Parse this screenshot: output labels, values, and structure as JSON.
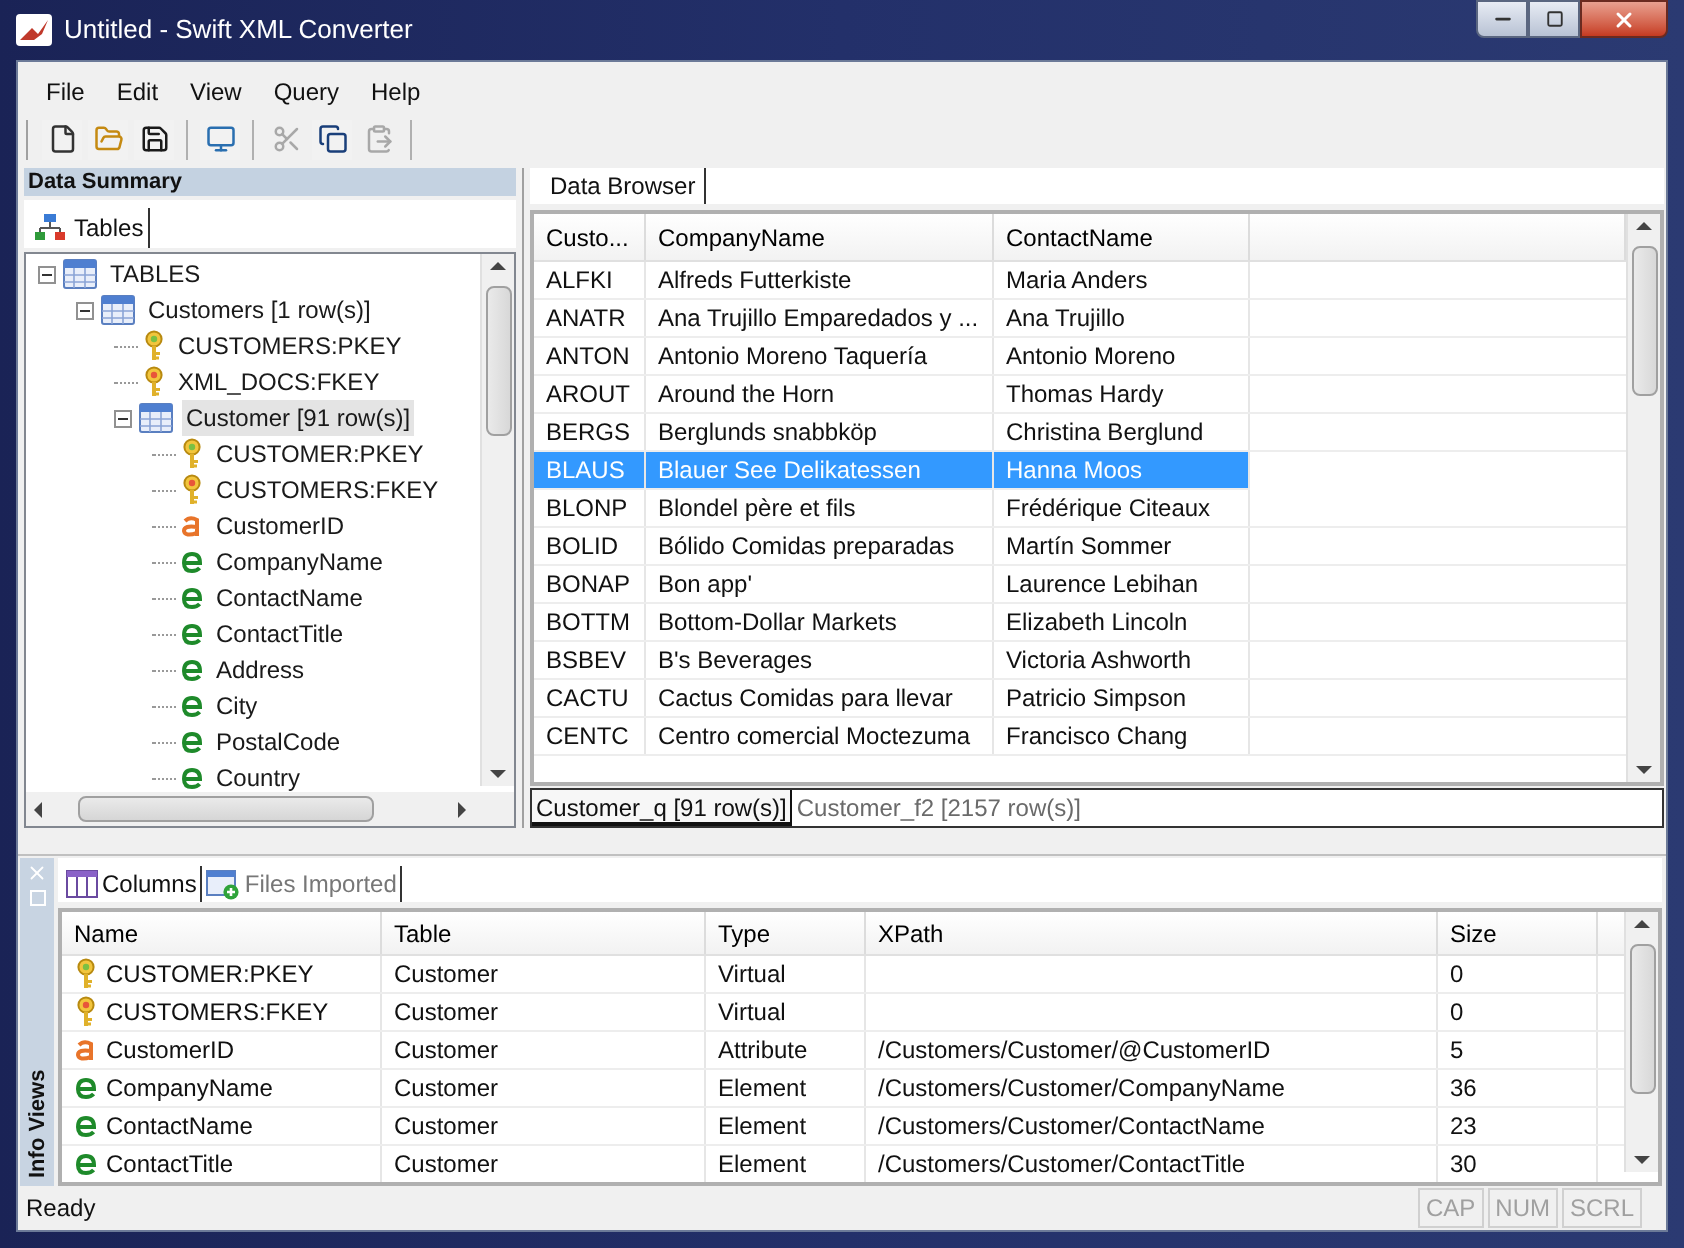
{
  "window": {
    "title": "Untitled - Swift XML Converter"
  },
  "menu": [
    "File",
    "Edit",
    "View",
    "Query",
    "Help"
  ],
  "toolbar": [
    {
      "kind": "new",
      "disabled": false
    },
    {
      "kind": "open",
      "disabled": false
    },
    {
      "kind": "save",
      "disabled": false
    },
    {
      "kind": "separator"
    },
    {
      "kind": "preview",
      "disabled": false
    },
    {
      "kind": "separator"
    },
    {
      "kind": "cut",
      "disabled": true
    },
    {
      "kind": "copy",
      "disabled": false
    },
    {
      "kind": "paste",
      "disabled": true
    }
  ],
  "data_summary": {
    "title": "Data Summary",
    "tabs": [
      {
        "label": "Tables",
        "selected": true
      }
    ],
    "tree": [
      {
        "label": "TABLES",
        "kind": "table",
        "expanded": true,
        "selected": false,
        "children": [
          {
            "label": "Customers [1 row(s)]",
            "kind": "table",
            "expanded": true,
            "selected": false,
            "children": [
              {
                "label": "CUSTOMERS:PKEY",
                "kind": "primary-key",
                "selected": false
              },
              {
                "label": "XML_DOCS:FKEY",
                "kind": "foreign-key",
                "selected": false
              },
              {
                "label": "Customer [91 row(s)]",
                "kind": "table",
                "expanded": true,
                "selected": true,
                "children": [
                  {
                    "label": "CUSTOMER:PKEY",
                    "kind": "primary-key",
                    "selected": false
                  },
                  {
                    "label": "CUSTOMERS:FKEY",
                    "kind": "foreign-key",
                    "selected": false
                  },
                  {
                    "label": "CustomerID",
                    "kind": "attribute",
                    "selected": false
                  },
                  {
                    "label": "CompanyName",
                    "kind": "element",
                    "selected": false
                  },
                  {
                    "label": "ContactName",
                    "kind": "element",
                    "selected": false
                  },
                  {
                    "label": "ContactTitle",
                    "kind": "element",
                    "selected": false
                  },
                  {
                    "label": "Address",
                    "kind": "element",
                    "selected": false
                  },
                  {
                    "label": "City",
                    "kind": "element",
                    "selected": false
                  },
                  {
                    "label": "PostalCode",
                    "kind": "element",
                    "selected": false
                  },
                  {
                    "label": "Country",
                    "kind": "element",
                    "selected": false
                  }
                ]
              }
            ]
          }
        ]
      }
    ]
  },
  "data_browser": {
    "tab": "Data Browser",
    "columns": [
      "Custo...",
      "CompanyName",
      "ContactName"
    ],
    "rows": [
      {
        "cells": [
          "ALFKI",
          "Alfreds Futterkiste",
          "Maria Anders"
        ],
        "selected": false
      },
      {
        "cells": [
          "ANATR",
          "Ana Trujillo Emparedados y ...",
          "Ana Trujillo"
        ],
        "selected": false
      },
      {
        "cells": [
          "ANTON",
          "Antonio Moreno Taquería",
          "Antonio Moreno"
        ],
        "selected": false
      },
      {
        "cells": [
          "AROUT",
          "Around the Horn",
          "Thomas Hardy"
        ],
        "selected": false
      },
      {
        "cells": [
          "BERGS",
          "Berglunds snabbköp",
          "Christina Berglund"
        ],
        "selected": false
      },
      {
        "cells": [
          "BLAUS",
          "Blauer See Delikatessen",
          "Hanna Moos"
        ],
        "selected": true
      },
      {
        "cells": [
          "BLONP",
          "Blondel père et fils",
          "Frédérique Citeaux"
        ],
        "selected": false
      },
      {
        "cells": [
          "BOLID",
          "Bólido Comidas preparadas",
          "Martín Sommer"
        ],
        "selected": false
      },
      {
        "cells": [
          "BONAP",
          "Bon app'",
          "Laurence Lebihan"
        ],
        "selected": false
      },
      {
        "cells": [
          "BOTTM",
          "Bottom-Dollar Markets",
          "Elizabeth Lincoln"
        ],
        "selected": false
      },
      {
        "cells": [
          "BSBEV",
          "B's Beverages",
          "Victoria Ashworth"
        ],
        "selected": false
      },
      {
        "cells": [
          "CACTU",
          "Cactus Comidas para llevar",
          "Patricio Simpson"
        ],
        "selected": false
      },
      {
        "cells": [
          "CENTC",
          "Centro comercial Moctezuma",
          "Francisco Chang"
        ],
        "selected": false
      }
    ],
    "result_tabs": [
      {
        "label": "Customer_q [91 row(s)]",
        "selected": true
      },
      {
        "label": "Customer_f2 [2157 row(s)]",
        "selected": false
      }
    ]
  },
  "info_views": {
    "title": "Info Views",
    "tabs": [
      {
        "label": "Columns",
        "kind": "columns",
        "selected": true
      },
      {
        "label": "Files Imported",
        "kind": "files",
        "selected": false
      }
    ],
    "columns": [
      "Name",
      "Table",
      "Type",
      "XPath",
      "Size"
    ],
    "rows": [
      {
        "kind": "primary-key",
        "cells": [
          "CUSTOMER:PKEY",
          "Customer",
          "Virtual",
          "",
          "0"
        ]
      },
      {
        "kind": "foreign-key",
        "cells": [
          "CUSTOMERS:FKEY",
          "Customer",
          "Virtual",
          "",
          "0"
        ]
      },
      {
        "kind": "attribute",
        "cells": [
          "CustomerID",
          "Customer",
          "Attribute",
          "/Customers/Customer/@CustomerID",
          "5"
        ]
      },
      {
        "kind": "element",
        "cells": [
          "CompanyName",
          "Customer",
          "Element",
          "/Customers/Customer/CompanyName",
          "36"
        ]
      },
      {
        "kind": "element",
        "cells": [
          "ContactName",
          "Customer",
          "Element",
          "/Customers/Customer/ContactName",
          "23"
        ]
      },
      {
        "kind": "element",
        "cells": [
          "ContactTitle",
          "Customer",
          "Element",
          "/Customers/Customer/ContactTitle",
          "30"
        ]
      }
    ]
  },
  "status_bar": {
    "text": "Ready",
    "indicators": [
      {
        "label": "CAP",
        "on": false
      },
      {
        "label": "NUM",
        "on": false
      },
      {
        "label": "SCRL",
        "on": false
      }
    ]
  }
}
